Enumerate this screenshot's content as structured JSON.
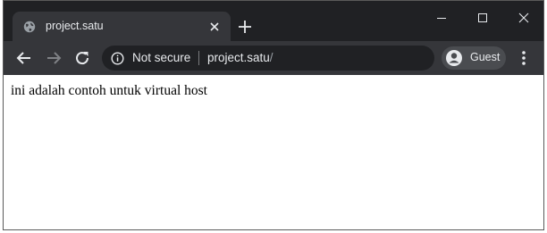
{
  "tab": {
    "title": "project.satu",
    "favicon": "globe-icon"
  },
  "window_controls": [
    "minimize-icon",
    "maximize-icon",
    "close-icon"
  ],
  "toolbar": {
    "security_label": "Not secure",
    "url_host": "project.satu",
    "url_path": "/",
    "profile_label": "Guest"
  },
  "page": {
    "body_text": "ini adalah contoh untuk virtual host"
  },
  "colors": {
    "titlebar": "#202124",
    "toolbar": "#35363a",
    "omnibox": "#202124",
    "text_light": "#e8eaed"
  }
}
